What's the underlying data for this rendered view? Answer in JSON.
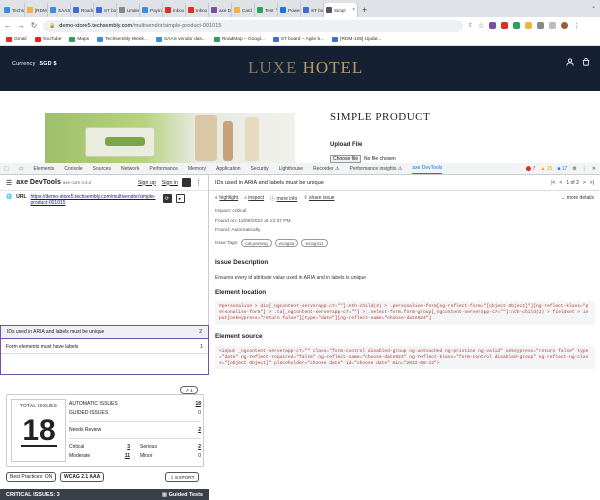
{
  "browser": {
    "tabs": [
      {
        "label": "Techs",
        "color": "#3a8dde"
      },
      {
        "label": "[RDM-",
        "color": "#f2b53c"
      },
      {
        "label": "SAAS",
        "color": "#3a8dde"
      },
      {
        "label": "Roadm",
        "color": "#3b6fd4"
      },
      {
        "label": "ST bo",
        "color": "#3b6fd4"
      },
      {
        "label": "Under",
        "color": "#888888"
      },
      {
        "label": "Paym",
        "color": "#3a8dde"
      },
      {
        "label": "Inbox",
        "color": "#d93025"
      },
      {
        "label": "Inbox",
        "color": "#d93025"
      },
      {
        "label": "axe D",
        "color": "#7a4ea1"
      },
      {
        "label": "Card",
        "color": "#f2b53c"
      },
      {
        "label": "Test",
        "color": "#2e9e5b"
      },
      {
        "label": "Power",
        "color": "#1a73e8"
      },
      {
        "label": "ST bo",
        "color": "#3b6fd4"
      },
      {
        "label": "Simpl",
        "color": "#555555",
        "active": true
      }
    ],
    "new_tab": "+",
    "url_host": "demo-store5.techsembly.com",
    "url_path": "/multivendor/simple-product-001015",
    "bookmarks": [
      {
        "label": "Gmail",
        "color": "#d93025"
      },
      {
        "label": "YouTube",
        "color": "#e62117"
      },
      {
        "label": "Maps",
        "color": "#2e9e5b"
      },
      {
        "label": "Techsembly Week...",
        "color": "#3a8dde"
      },
      {
        "label": "SAAS vendor das...",
        "color": "#3a8dde"
      },
      {
        "label": "RoadMap – Googl...",
        "color": "#2e9e5b"
      },
      {
        "label": "ST board – Agile b...",
        "color": "#3b6fd4"
      },
      {
        "label": "[RDM-105] Updat...",
        "color": "#3b6fd4"
      }
    ]
  },
  "store": {
    "currency_label": "Currency",
    "currency_value": "SGD $",
    "logo_a": "LUXE",
    "logo_b": "HOTEL",
    "product_title": "SIMPLE PRODUCT",
    "upload_label": "Upload File",
    "choose_file": "Choose file",
    "no_file": "No file chosen"
  },
  "devtools_tabs": [
    "Elements",
    "Console",
    "Sources",
    "Network",
    "Performance",
    "Memory",
    "Application",
    "Security",
    "Lighthouse",
    "Recorder ⚠",
    "Performance insights ⚠",
    "axe DevTools"
  ],
  "devtools_counts": {
    "errors": "7",
    "warnings": "15",
    "info": "17"
  },
  "axe": {
    "brand": "axe DevTools",
    "brand_sub": "axe core",
    "version": "4.4.2",
    "signup": "Sign up",
    "signin": "Sign in",
    "url_label": "URL",
    "url": "https://demo-store5.techsembly.com/multivendor/simple-product-001015",
    "run_badge": "↗ 1",
    "total_label": "TOTAL ISSUES",
    "total": "18",
    "automatic_label": "AUTOMATIC ISSUES",
    "automatic": "18",
    "guided_label": "GUIDED ISSUES",
    "guided": "0",
    "needs_review_label": "Needs Review",
    "needs_review": "2",
    "critical_label": "Critical",
    "critical": "3",
    "serious_label": "Serious",
    "serious": "2",
    "moderate_label": "Moderate",
    "moderate": "11",
    "minor_label": "Minor",
    "minor": "0",
    "best_practices": "Best Practices: ON",
    "wcag": "WCAG 2.1 AAA",
    "export": "EXPORT",
    "critical_header": "CRITICAL ISSUES: 3",
    "guided_tests": "Guided Tests",
    "issues": [
      {
        "label": "IDs used in ARIA and labels must be unique",
        "count": "2"
      },
      {
        "label": "Form elements must have labels",
        "count": "1"
      }
    ]
  },
  "detail": {
    "title": "IDs used in ARIA and labels must be unique",
    "page_of": "1 of 2",
    "highlight": "highlight",
    "inspect": "inspect",
    "more_info": "more info",
    "share": "share issue",
    "more_details": "more details",
    "impact": "Impact: critical",
    "found_on": "Found on: 12/08/2022 at 12:37 PM",
    "found": "Found: Automatically",
    "tags_label": "Issue Tags:",
    "tags": [
      "cat.parsing",
      "wcag2a",
      "wcag411"
    ],
    "desc_heading": "Issue Description",
    "desc_text": "Ensures every id attribute value used in ARIA and in labels is unique",
    "loc_heading": "Element location",
    "loc_code": "#personalise > div[_ngcontent-serverapp-c7=\"\"]:nth-child(3) > .personalise-form[ng-reflect-form=\"[object Object]\"][ng-reflect-klass=\"personalise-form\"] > .ta[_ngcontent-serverapp-c7=\"\"] > .select-form.form-group[_ngcontent-serverapp-c7=\"\"]:nth-child(2) > fieldset > input[onkeypress=\"return false\"][type=\"date\"][ng-reflect-name=\"choose-date924\"]",
    "src_heading": "Element source",
    "src_code": "<input _ngcontent-serverapp-c7=\"\" class=\"form-control disabled-group ng-untouched ng-pristine ng-valid\" onkeypress=\"return false\" type=\"date\" ng-reflect-required=\"false\" ng-reflect-name=\"choose-date924\" ng-reflect-klass=\"form-control disabled-group\" ng-reflect-ng-class=\"[object Object]\" placeholder=\"choose date\" id=\"choose date\" min=\"2022-08-12\">"
  }
}
